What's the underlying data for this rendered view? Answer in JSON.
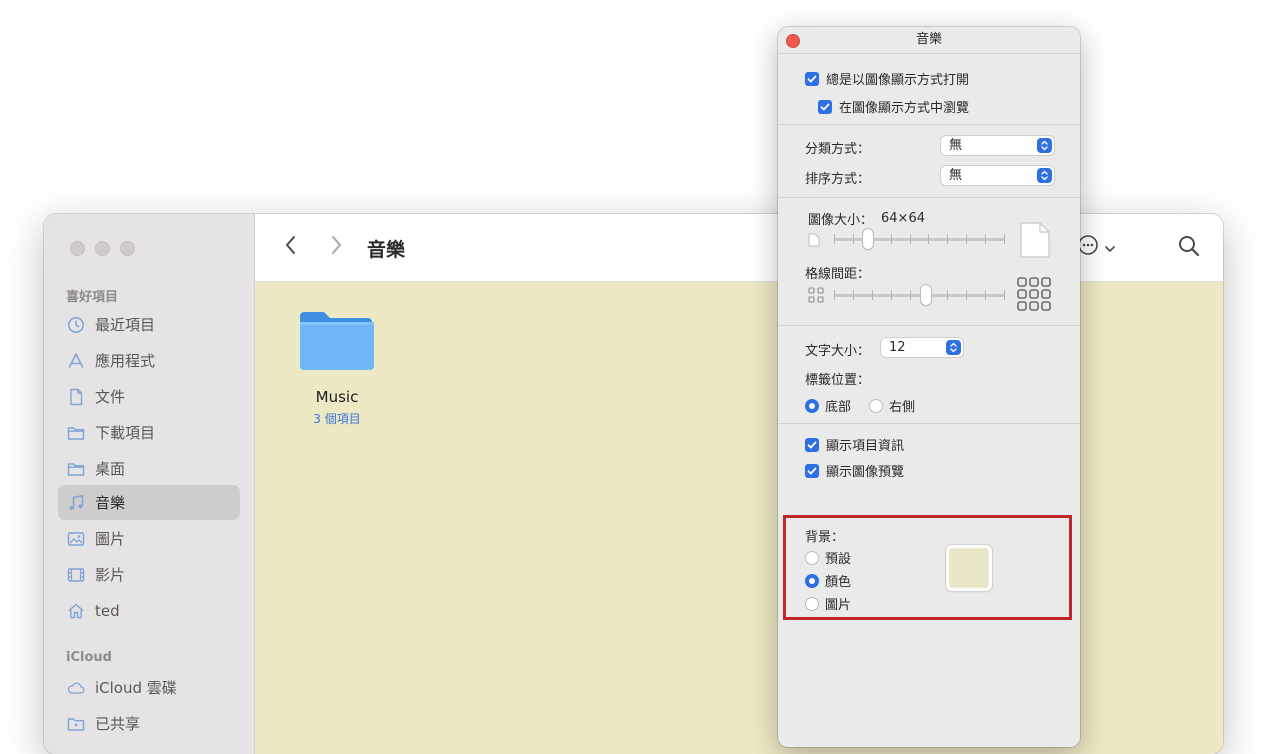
{
  "finder": {
    "title": "音樂",
    "sidebar": {
      "favorites_title": "喜好項目",
      "favorites": [
        {
          "label": "最近項目",
          "icon": "clock-icon"
        },
        {
          "label": "應用程式",
          "icon": "apps-icon"
        },
        {
          "label": "文件",
          "icon": "document-icon"
        },
        {
          "label": "下載項目",
          "icon": "folder-icon"
        },
        {
          "label": "桌面",
          "icon": "folder-icon"
        },
        {
          "label": "音樂",
          "icon": "music-icon",
          "selected": true
        },
        {
          "label": "圖片",
          "icon": "photo-icon"
        },
        {
          "label": "影片",
          "icon": "film-icon"
        },
        {
          "label": "ted",
          "icon": "home-icon"
        }
      ],
      "icloud_title": "iCloud",
      "icloud": [
        {
          "label": "iCloud 雲碟",
          "icon": "cloud-icon"
        },
        {
          "label": "已共享",
          "icon": "shared-folder-icon"
        }
      ]
    },
    "items": [
      {
        "name": "Music",
        "info": "3 個項目"
      }
    ],
    "background_color": "#ece9c4"
  },
  "view_options": {
    "title": "音樂",
    "always_open_icon_view": "總是以圖像顯示方式打開",
    "browse_icon_view": "在圖像顯示方式中瀏覽",
    "group_by_label": "分類方式：",
    "group_by_value": "無",
    "sort_by_label": "排序方式：",
    "sort_by_value": "無",
    "icon_size_label": "圖像大小：",
    "icon_size_value": "64×64",
    "icon_size_level": 0.2,
    "grid_spacing_label": "格線間距：",
    "grid_spacing_level": 0.54,
    "text_size_label": "文字大小：",
    "text_size_value": "12",
    "label_position_label": "標籤位置：",
    "label_bottom": "底部",
    "label_right": "右側",
    "show_item_info": "顯示項目資訊",
    "show_icon_preview": "顯示圖像預覽",
    "background_label": "背景：",
    "bg_default": "預設",
    "bg_color": "顏色",
    "bg_picture": "圖片",
    "selected_background": "color",
    "swatch_color": "#e8e6c6",
    "accent_color": "#2f6fe4",
    "highlight_color": "#c0262a"
  }
}
